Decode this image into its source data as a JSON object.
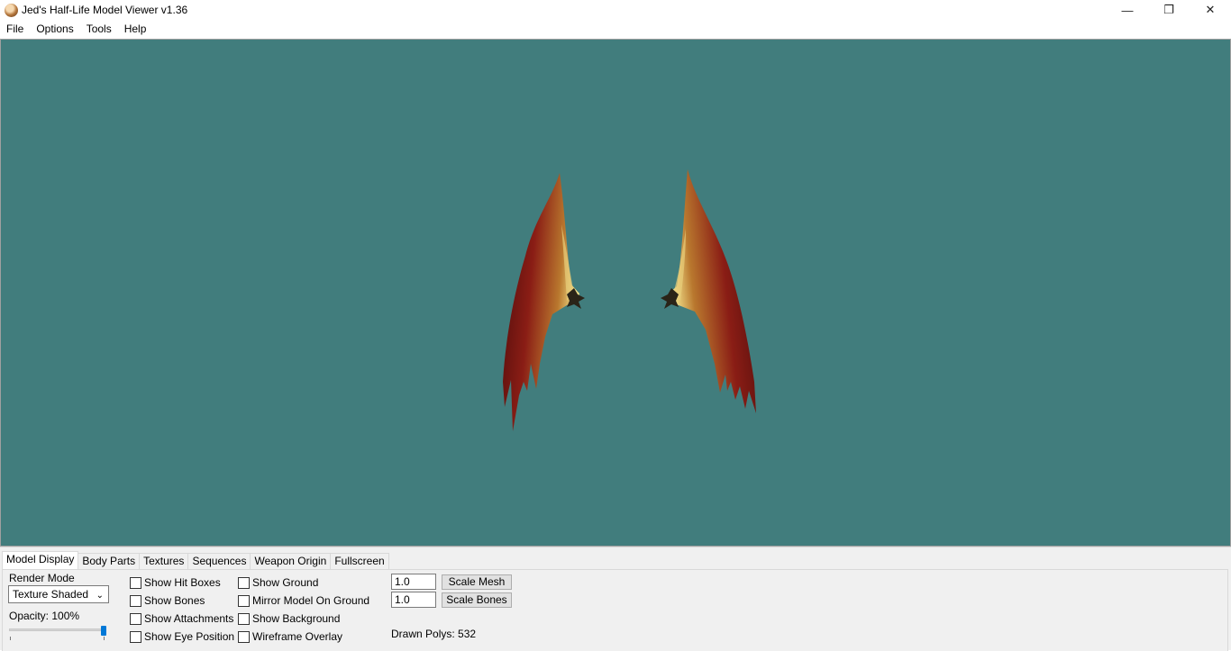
{
  "window": {
    "title": "Jed's Half-Life Model Viewer v1.36",
    "controls": {
      "minimize": "—",
      "restore": "❐",
      "close": "✕"
    }
  },
  "menu": [
    "File",
    "Options",
    "Tools",
    "Help"
  ],
  "viewport": {
    "background": "#417d7d",
    "model": "bat-wings"
  },
  "tabs": [
    "Model Display",
    "Body Parts",
    "Textures",
    "Sequences",
    "Weapon Origin",
    "Fullscreen"
  ],
  "active_tab": 0,
  "model_display": {
    "render_mode_label": "Render Mode",
    "render_mode_value": "Texture Shaded",
    "opacity_label": "Opacity: 100%",
    "opacity": 1.0,
    "checkboxes_col1": [
      {
        "label": "Show Hit Boxes",
        "checked": false
      },
      {
        "label": "Show Bones",
        "checked": false
      },
      {
        "label": "Show Attachments",
        "checked": false
      },
      {
        "label": "Show Eye Position",
        "checked": false
      }
    ],
    "checkboxes_col2": [
      {
        "label": "Show Ground",
        "checked": false
      },
      {
        "label": "Mirror Model On Ground",
        "checked": false
      },
      {
        "label": "Show Background",
        "checked": false
      },
      {
        "label": "Wireframe Overlay",
        "checked": false
      }
    ],
    "scale_mesh_value": "1.0",
    "scale_mesh_label": "Scale Mesh",
    "scale_bones_value": "1.0",
    "scale_bones_label": "Scale Bones",
    "drawn_polys": "Drawn Polys: 532"
  }
}
